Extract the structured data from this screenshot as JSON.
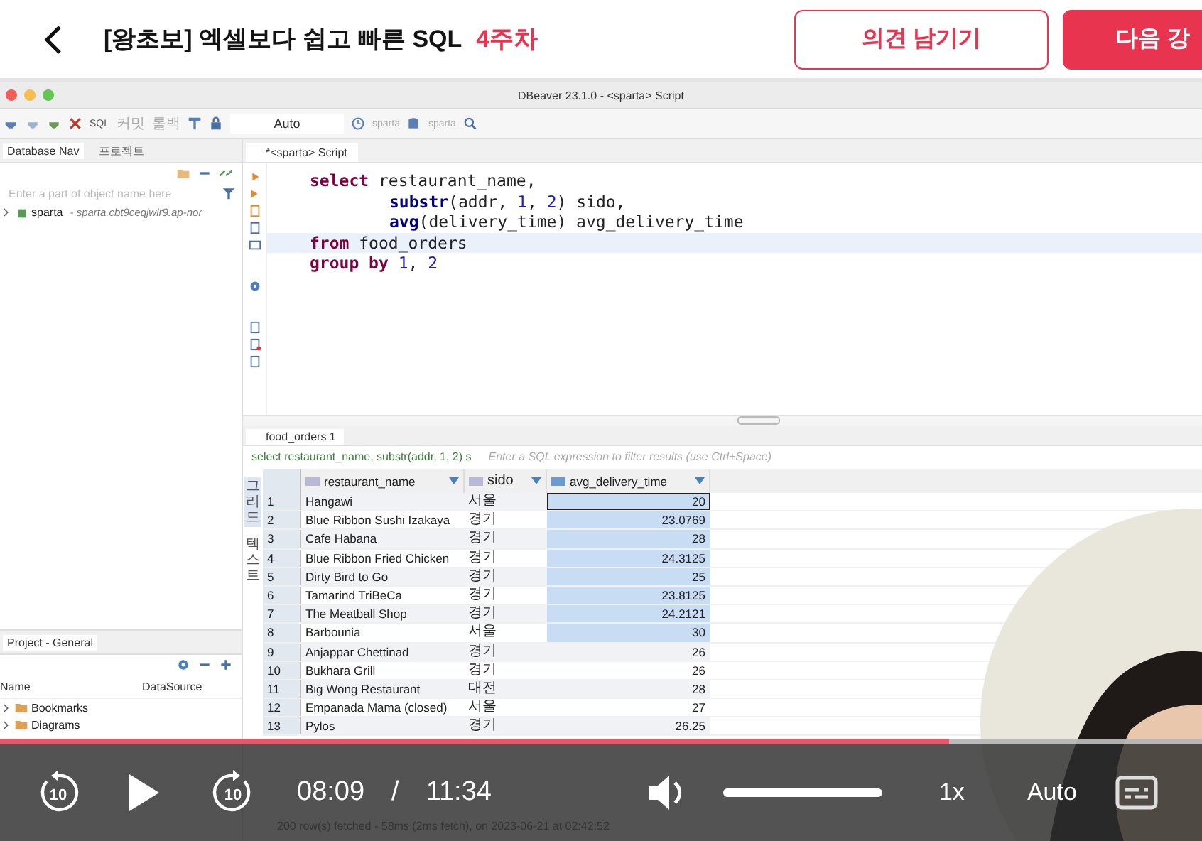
{
  "header": {
    "title": "[왕초보] 엑셀보다 쉽고 빠른 SQL",
    "week": "4주차",
    "buttons": [
      {
        "label": "의견 남기기",
        "kind": "outline"
      },
      {
        "label": "다음 강",
        "kind": "primary"
      }
    ]
  },
  "app": {
    "title": "DBeaver 23.1.0 - <sparta> Script",
    "toolbar": {
      "sql": "SQL",
      "commit": "커밋",
      "rollback": "롤백",
      "mode": "Auto",
      "datasource": "sparta",
      "schema": "sparta"
    },
    "navigator": {
      "tabs": [
        {
          "label": "Database Nav",
          "selected": true
        },
        {
          "label": "프로젝트",
          "selected": false
        }
      ],
      "filter_placeholder": "Enter a part of object name here",
      "tree": [
        {
          "name": "sparta",
          "detail": "- sparta.cbt9ceqjwlr9.ap-nor"
        }
      ]
    },
    "project": {
      "tab": "Project - General",
      "columns": [
        "Name",
        "DataSource"
      ],
      "items": [
        "Bookmarks",
        "Diagrams"
      ]
    },
    "editor": {
      "tab": "*<sparta> Script",
      "code": [
        {
          "current": false,
          "indent": false,
          "tokens": [
            {
              "kind": "keyword",
              "text": "select"
            },
            {
              "kind": "plain",
              "text": " restaurant_name,"
            }
          ]
        },
        {
          "current": false,
          "indent": true,
          "tokens": [
            {
              "kind": "function",
              "text": "substr"
            },
            {
              "kind": "plain",
              "text": "(addr, "
            },
            {
              "kind": "number",
              "text": "1"
            },
            {
              "kind": "plain",
              "text": ", "
            },
            {
              "kind": "number",
              "text": "2"
            },
            {
              "kind": "plain",
              "text": ") sido,"
            }
          ]
        },
        {
          "current": false,
          "indent": true,
          "tokens": [
            {
              "kind": "function",
              "text": "avg"
            },
            {
              "kind": "plain",
              "text": "(delivery_time) avg_delivery_time"
            }
          ]
        },
        {
          "current": true,
          "indent": false,
          "tokens": [
            {
              "kind": "keyword",
              "text": "from"
            },
            {
              "kind": "plain",
              "text": " food_orders"
            }
          ]
        },
        {
          "current": false,
          "indent": false,
          "tokens": [
            {
              "kind": "keyword",
              "text": "group by "
            },
            {
              "kind": "number",
              "text": "1"
            },
            {
              "kind": "plain",
              "text": ", "
            },
            {
              "kind": "number",
              "text": "2"
            }
          ]
        }
      ]
    },
    "results": {
      "tab": "food_orders 1",
      "query": "select restaurant_name, substr(addr, 1, 2) s",
      "filter_placeholder": "Enter a SQL expression to filter results (use Ctrl+Space)",
      "side_tabs": [
        {
          "label": "그리드",
          "selected": true
        },
        {
          "label": "텍스트",
          "selected": false
        }
      ],
      "columns": [
        "restaurant_name",
        "sido",
        "avg_delivery_time"
      ],
      "rows": [
        {
          "num": "1",
          "name": "Hangawi",
          "sido": "서울",
          "avg": "20",
          "selected": true,
          "focused": true
        },
        {
          "num": "2",
          "name": "Blue Ribbon Sushi Izakaya",
          "sido": "경기",
          "avg": "23.0769",
          "selected": true,
          "focused": false
        },
        {
          "num": "3",
          "name": "Cafe Habana",
          "sido": "경기",
          "avg": "28",
          "selected": true,
          "focused": false
        },
        {
          "num": "4",
          "name": "Blue Ribbon Fried Chicken",
          "sido": "경기",
          "avg": "24.3125",
          "selected": true,
          "focused": false
        },
        {
          "num": "5",
          "name": "Dirty Bird to Go",
          "sido": "경기",
          "avg": "25",
          "selected": true,
          "focused": false
        },
        {
          "num": "6",
          "name": "Tamarind TriBeCa",
          "sido": "경기",
          "avg": "23.8125",
          "selected": true,
          "focused": false
        },
        {
          "num": "7",
          "name": "The Meatball Shop",
          "sido": "경기",
          "avg": "24.2121",
          "selected": true,
          "focused": false
        },
        {
          "num": "8",
          "name": "Barbounia",
          "sido": "서울",
          "avg": "30",
          "selected": true,
          "focused": false
        },
        {
          "num": "9",
          "name": "Anjappar Chettinad",
          "sido": "경기",
          "avg": "26",
          "selected": false,
          "focused": false
        },
        {
          "num": "10",
          "name": "Bukhara Grill",
          "sido": "경기",
          "avg": "26",
          "selected": false,
          "focused": false
        },
        {
          "num": "11",
          "name": "Big Wong Restaurant",
          "sido": "대전",
          "avg": "28",
          "selected": false,
          "focused": false
        },
        {
          "num": "12",
          "name": "Empanada Mama (closed)",
          "sido": "서울",
          "avg": "27",
          "selected": false,
          "focused": false
        },
        {
          "num": "13",
          "name": "Pylos",
          "sido": "경기",
          "avg": "26.25",
          "selected": false,
          "focused": false
        }
      ],
      "status": "200 row(s) fetched - 58ms (2ms fetch), on 2023-06-21 at 02:42:52"
    }
  },
  "player": {
    "progress": {
      "level": 0.79
    },
    "skip_back": "10",
    "skip_forward": "10",
    "current_time": "08:09",
    "separator": "/",
    "duration": "11:34",
    "volume": {
      "level": 1
    },
    "speed": "1x",
    "quality": "Auto"
  }
}
